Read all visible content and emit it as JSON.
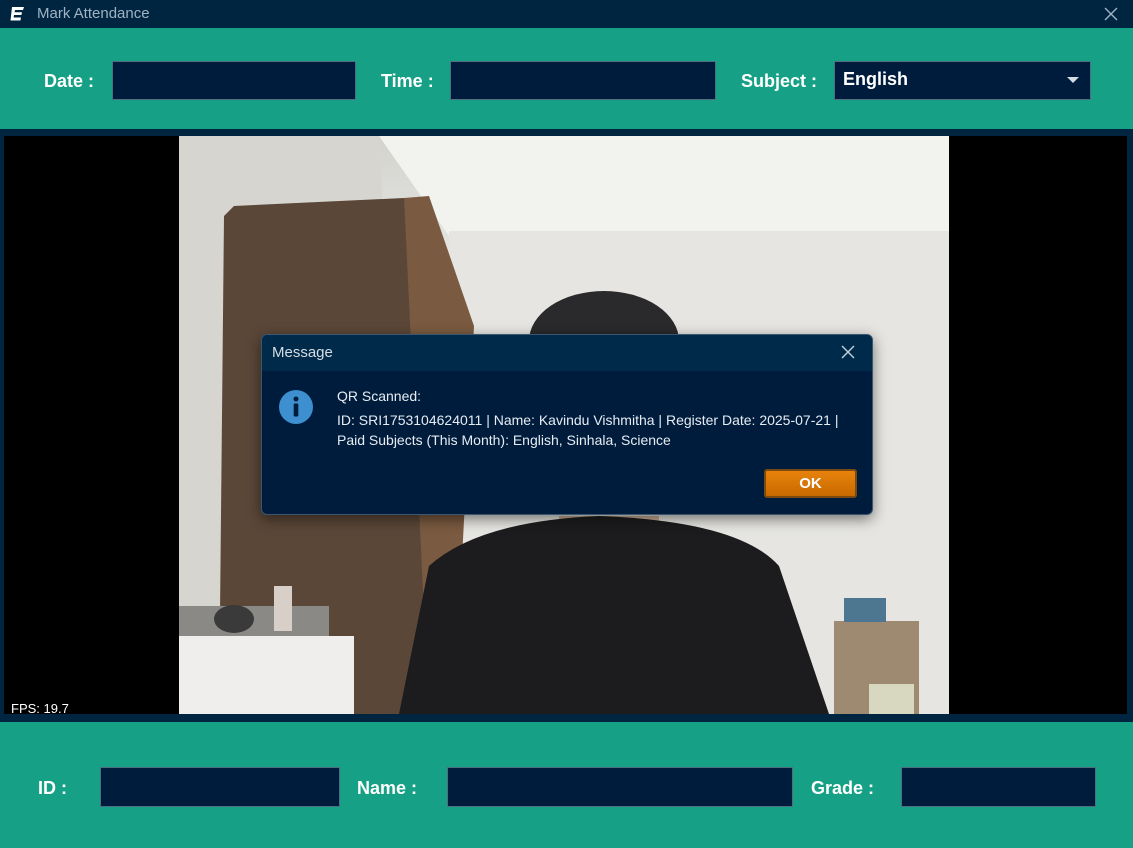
{
  "window": {
    "title": "Mark Attendance"
  },
  "top": {
    "date_label": "Date :",
    "date_value": "",
    "time_label": "Time :",
    "time_value": "",
    "subject_label": "Subject :",
    "subject_value": "English"
  },
  "camera": {
    "fps_text": "FPS: 19.7"
  },
  "dialog": {
    "title": "Message",
    "line1": "QR Scanned:",
    "line2": "ID: SRI1753104624011 | Name: Kavindu Vishmitha | Register Date: 2025-07-21 |",
    "line3": "Paid Subjects (This Month): English, Sinhala, Science",
    "ok_label": "OK"
  },
  "bottom": {
    "id_label": "ID :",
    "id_value": "",
    "name_label": "Name :",
    "name_value": "",
    "grade_label": "Grade :",
    "grade_value": ""
  },
  "colors": {
    "primary_bg": "#16a085",
    "dark_navy": "#001c3d",
    "titlebar": "#002540",
    "ok_button": "#e8820c",
    "info_icon": "#3d8fd0"
  },
  "icons": {
    "app": "app-logo-icon",
    "close": "close-icon",
    "dropdown": "chevron-down-icon",
    "info": "info-icon"
  }
}
